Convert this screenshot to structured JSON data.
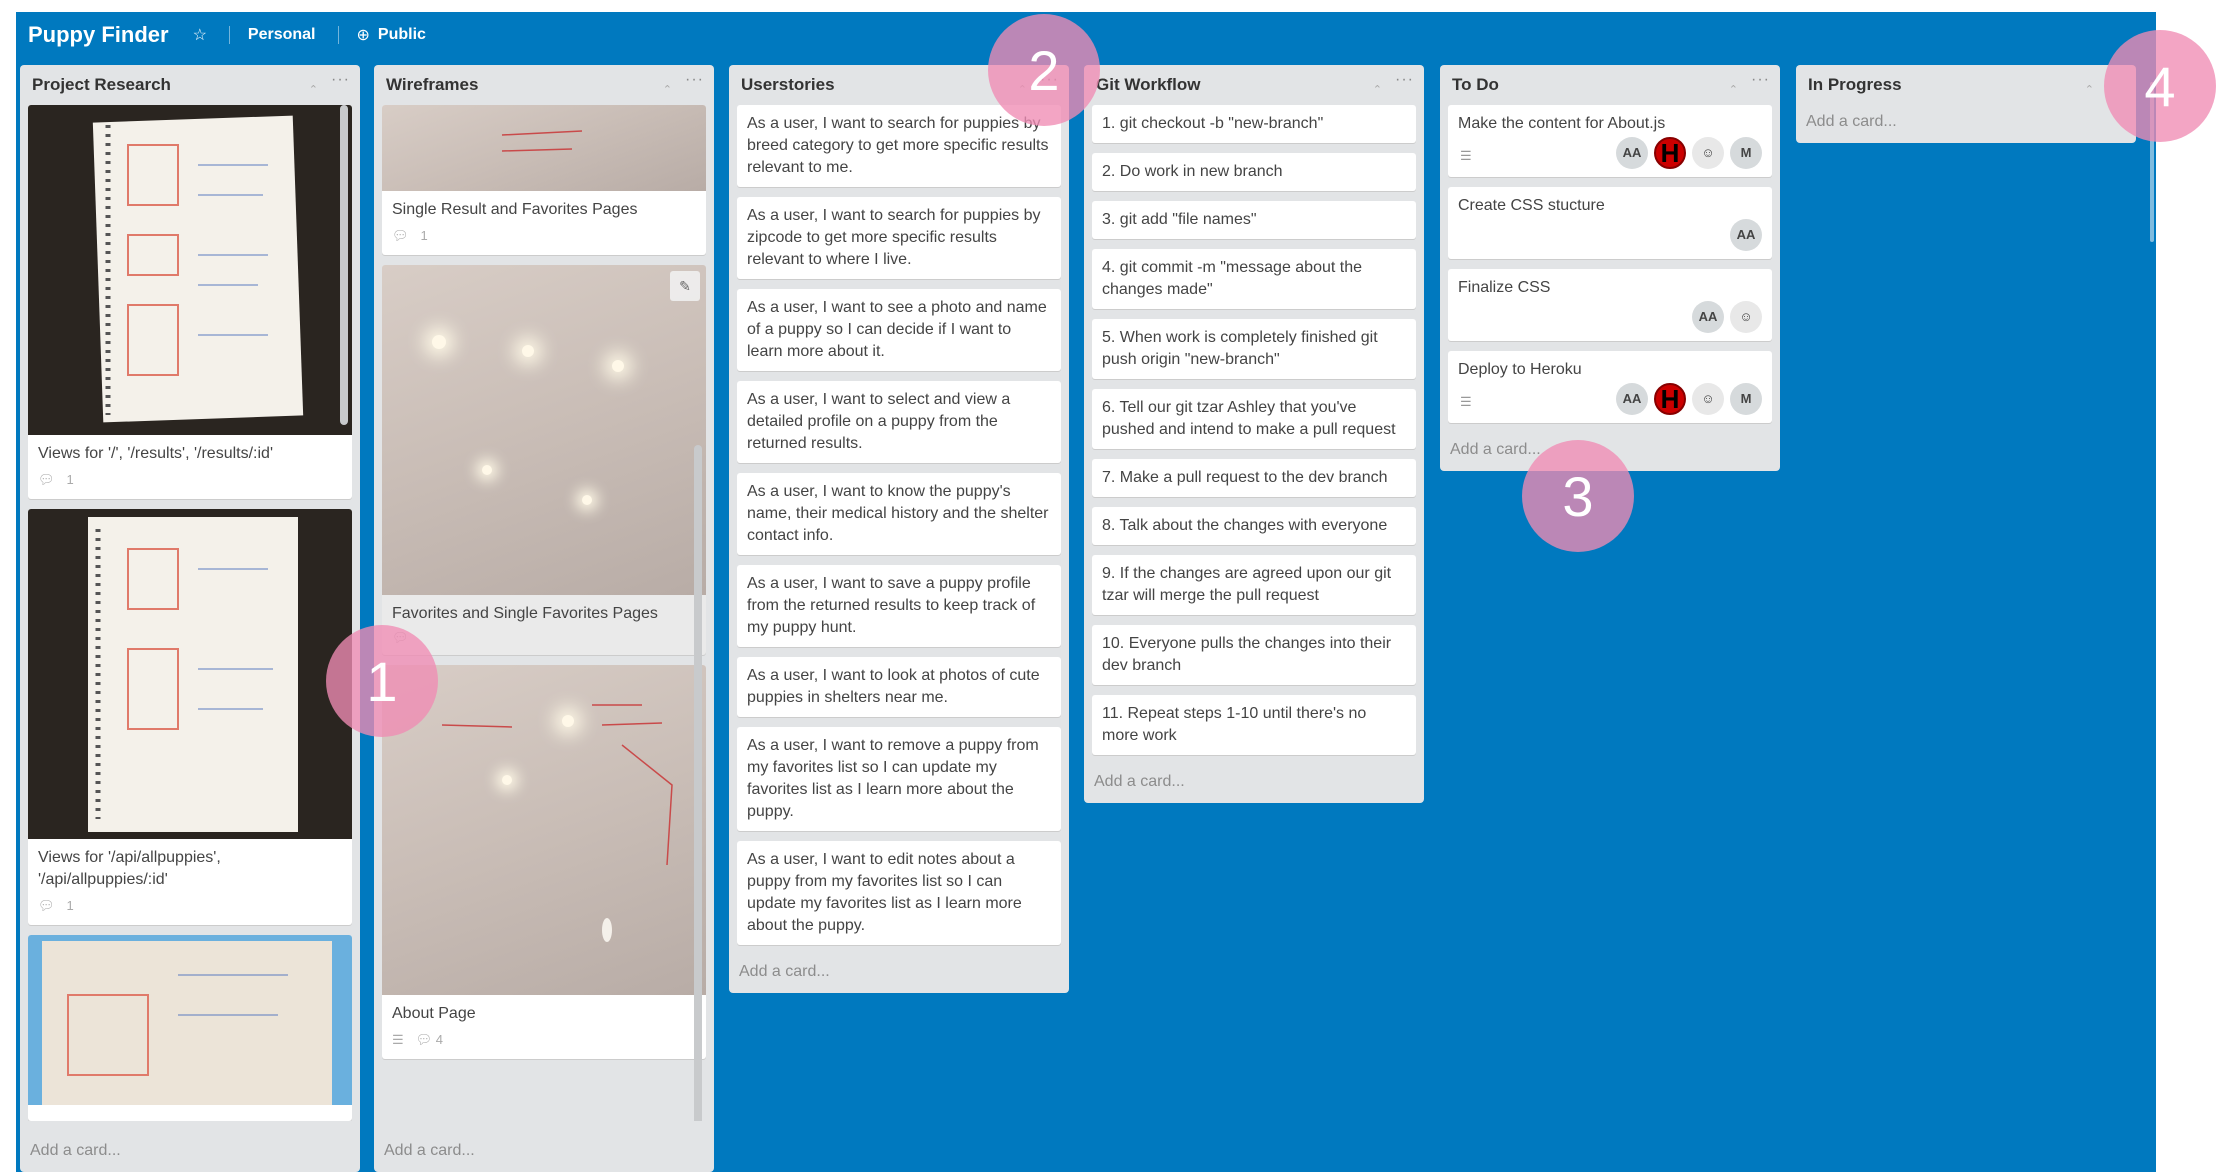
{
  "board": {
    "title": "Puppy Finder",
    "personal_label": "Personal",
    "public_label": "Public"
  },
  "lists": {
    "project_research": {
      "title": "Project Research",
      "cards": [
        {
          "title": "Views for '/', '/results', '/results/:id'",
          "comments": "1"
        },
        {
          "title": "Views for '/api/allpuppies', '/api/allpuppies/:id'",
          "comments": "1"
        }
      ],
      "add_card": "Add a card..."
    },
    "wireframes": {
      "title": "Wireframes",
      "cards": [
        {
          "title": "Single Result and Favorites Pages",
          "comments": "1"
        },
        {
          "title": "Favorites and Single Favorites Pages"
        },
        {
          "title": "About Page",
          "comments": "4"
        }
      ],
      "add_card": "Add a card..."
    },
    "userstories": {
      "title": "Userstories",
      "cards": [
        "As a user, I want to search for puppies by breed category to get more specific results relevant to me.",
        "As a user, I want to search for puppies by zipcode to get more specific results relevant to where I live.",
        "As a user, I want to see a photo and name of a puppy so I can decide if I want to learn more about it.",
        "As a user, I want to select and view a detailed profile on a puppy from the returned results.",
        "As a user, I want to know the puppy's name, their medical history and the shelter contact info.",
        "As a user, I want to save a puppy profile from the returned results to keep track of my puppy hunt.",
        "As a user, I want to look at photos of cute puppies in shelters near me.",
        "As a user, I want to remove a puppy from my favorites list so I can update my favorites list as I learn more about the puppy.",
        "As a user, I want to edit notes about a puppy from my favorites list so I can update my favorites list as I learn more about the puppy."
      ],
      "add_card": "Add a card..."
    },
    "git_workflow": {
      "title": "Git Workflow",
      "cards": [
        "1. git checkout -b \"new-branch\"",
        "2. Do work in new branch",
        "3. git add \"file names\"",
        "4. git commit -m \"message about the changes made\"",
        "5. When work is completely finished git push origin \"new-branch\"",
        "6. Tell our git tzar Ashley that you've pushed and intend to make a pull request",
        "7. Make a pull request to the dev branch",
        "8. Talk about the changes with everyone",
        "9. If the changes are agreed upon our git tzar will merge the pull request",
        "10. Everyone pulls the changes into their dev branch",
        "11. Repeat steps 1-10 until there's no more work"
      ],
      "add_card": "Add a card..."
    },
    "todo": {
      "title": "To Do",
      "cards": [
        {
          "title": "Make the content for About.js",
          "members": [
            "AA",
            "H",
            "",
            "M"
          ]
        },
        {
          "title": "Create CSS stucture",
          "members": [
            "AA"
          ]
        },
        {
          "title": "Finalize CSS",
          "members": [
            "AA",
            ""
          ]
        },
        {
          "title": "Deploy to Heroku",
          "members": [
            "AA",
            "H",
            "",
            "M"
          ]
        }
      ],
      "add_card": "Add a card..."
    },
    "in_progress": {
      "title": "In Progress",
      "add_card": "Add a card..."
    }
  },
  "markers": [
    "1",
    "2",
    "3",
    "4"
  ],
  "colors": {
    "board_bg": "#0079bf",
    "list_bg": "#e2e4e6",
    "marker": "#f08cb4"
  }
}
